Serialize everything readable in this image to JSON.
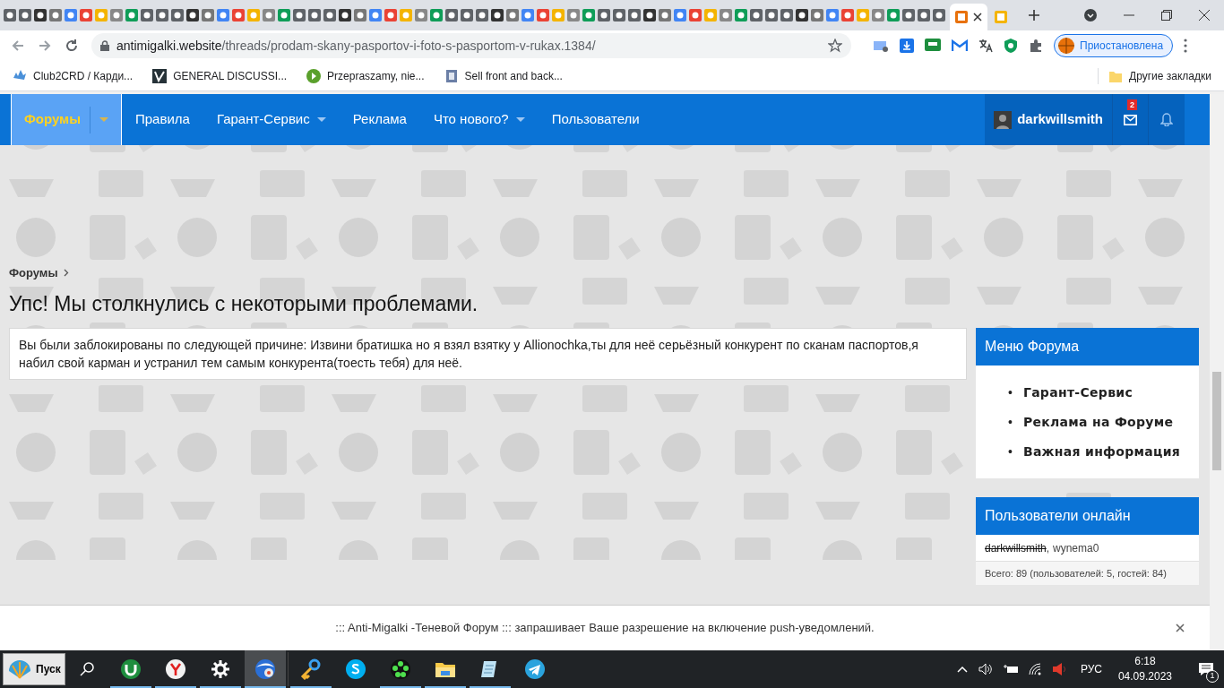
{
  "browser": {
    "tabs": [
      {
        "selected": true
      },
      {
        "selected": false
      }
    ],
    "url_host": "antimigalki.website",
    "url_path": "/threads/prodam-skany-pasportov-i-foto-s-pasportom-v-rukax.1384/",
    "profile": "Приостановлена",
    "bookmarks": [
      {
        "label": "Club2CRD / Карди..."
      },
      {
        "label": "GENERAL DISCUSSI..."
      },
      {
        "label": "Przepraszamy, nie..."
      },
      {
        "label": "Sell front and back..."
      }
    ],
    "other_bookmarks": "Другие закладки"
  },
  "nav": {
    "items": [
      {
        "label": "Форумы",
        "caret": true,
        "selected": true
      },
      {
        "label": "Правила",
        "caret": false,
        "selected": false
      },
      {
        "label": "Гарант-Сервис",
        "caret": true,
        "selected": false
      },
      {
        "label": "Реклама",
        "caret": false,
        "selected": false
      },
      {
        "label": "Что нового?",
        "caret": true,
        "selected": false
      },
      {
        "label": "Пользователи",
        "caret": false,
        "selected": false
      }
    ],
    "user": "darkwillsmith",
    "messages_badge": "2"
  },
  "breadcrumb": "Форумы",
  "title": "Упс! Мы столкнулись с некоторыми проблемами.",
  "error": "Вы были заблокированы по следующей причине: Извини братишка но я взял взятку у Allionochka,ты для неё серьёзный конкурент по сканам паспортов,я набил свой карман и устранил тем самым конкурента(тоесть тебя) для неё.",
  "sidebar": {
    "menu_title": "Меню Форума",
    "bullet": "•",
    "menu_items": [
      "Гарант-Сервис",
      "Реклама на Форуме",
      "Важная информация"
    ],
    "online_title": "Пользователи онлайн",
    "online_separator": ",",
    "online_users": [
      {
        "name": "darkwillsmith",
        "struck": true
      },
      {
        "name": "wynema0",
        "struck": false
      }
    ],
    "online_total": "Всего: 89 (пользователей: 5, гостей: 84)"
  },
  "push_notice": "::: Anti-Migalki -Теневой Форум ::: запрашивает Ваше разрешение на включение push-уведомлений.",
  "taskbar": {
    "start": "Пуск",
    "apps": [
      {
        "kind": "torrent",
        "running": true,
        "selected": false
      },
      {
        "kind": "yandex",
        "running": true,
        "selected": false
      },
      {
        "kind": "gear",
        "running": true,
        "selected": false
      },
      {
        "kind": "browser",
        "running": true,
        "selected": true
      },
      {
        "kind": "key",
        "running": true,
        "selected": false
      },
      {
        "kind": "skype",
        "running": false,
        "selected": false
      },
      {
        "kind": "flower",
        "running": true,
        "selected": false
      },
      {
        "kind": "folder",
        "running": true,
        "selected": false
      },
      {
        "kind": "notepad",
        "running": true,
        "selected": false
      },
      {
        "kind": "telegram",
        "running": false,
        "selected": false
      }
    ],
    "language": "РУС",
    "time": "6:18",
    "date": "04.09.2023",
    "notifications": "1"
  }
}
